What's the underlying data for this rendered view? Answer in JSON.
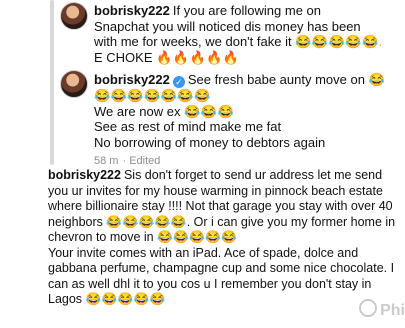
{
  "comment1": {
    "username": "bobrisky222",
    "line1": "If you are following me on",
    "line2": "Snapchat you will noticed dis money has been",
    "line3a": "with me for weeks, we don't fake it",
    "line3_emojis": "😂😂😂😂😂.",
    "line4a": "E CHOKE",
    "line4_emojis": "🔥🔥🔥🔥🔥"
  },
  "comment2": {
    "username": "bobrisky222",
    "line1": "See fresh babe aunty move on",
    "line1_emoji": "😂",
    "line2_emojis": "😂😂😂😂😂😂😂",
    "line3": "We are now ex",
    "line3_emojis": "😂😂😂",
    "line4": "See as rest of mind make me fat",
    "line5": "No borrowing of money to debtors again",
    "time": "58 m",
    "edited": "· Edited"
  },
  "comment3": {
    "username": "bobrisky222",
    "l1": "Sis don't forget to send ur address let me send",
    "l2": "you ur invites for my house warming in pinnock beach estate",
    "l3": "where billionaire stay !!!! Not that garage you stay with over 40",
    "l4a": "neighbors",
    "l4_emojis": "😂😂😂😂😂",
    "l4b": ". Or i can give you my former home in",
    "l5a": "chevron to move in",
    "l5_emojis": "😂😂😂😂😂",
    "l6": "Your invite comes with an iPad. Ace of spade, dolce and",
    "l7": "gabbana perfume, champagne cup and some nice chocolate. I",
    "l8": "can as well dhl it to you cos u I remember you don't stay in",
    "l9a": "Lagos",
    "l9_emojis": "😂😂😂😂😂"
  },
  "watermark": "Phi"
}
